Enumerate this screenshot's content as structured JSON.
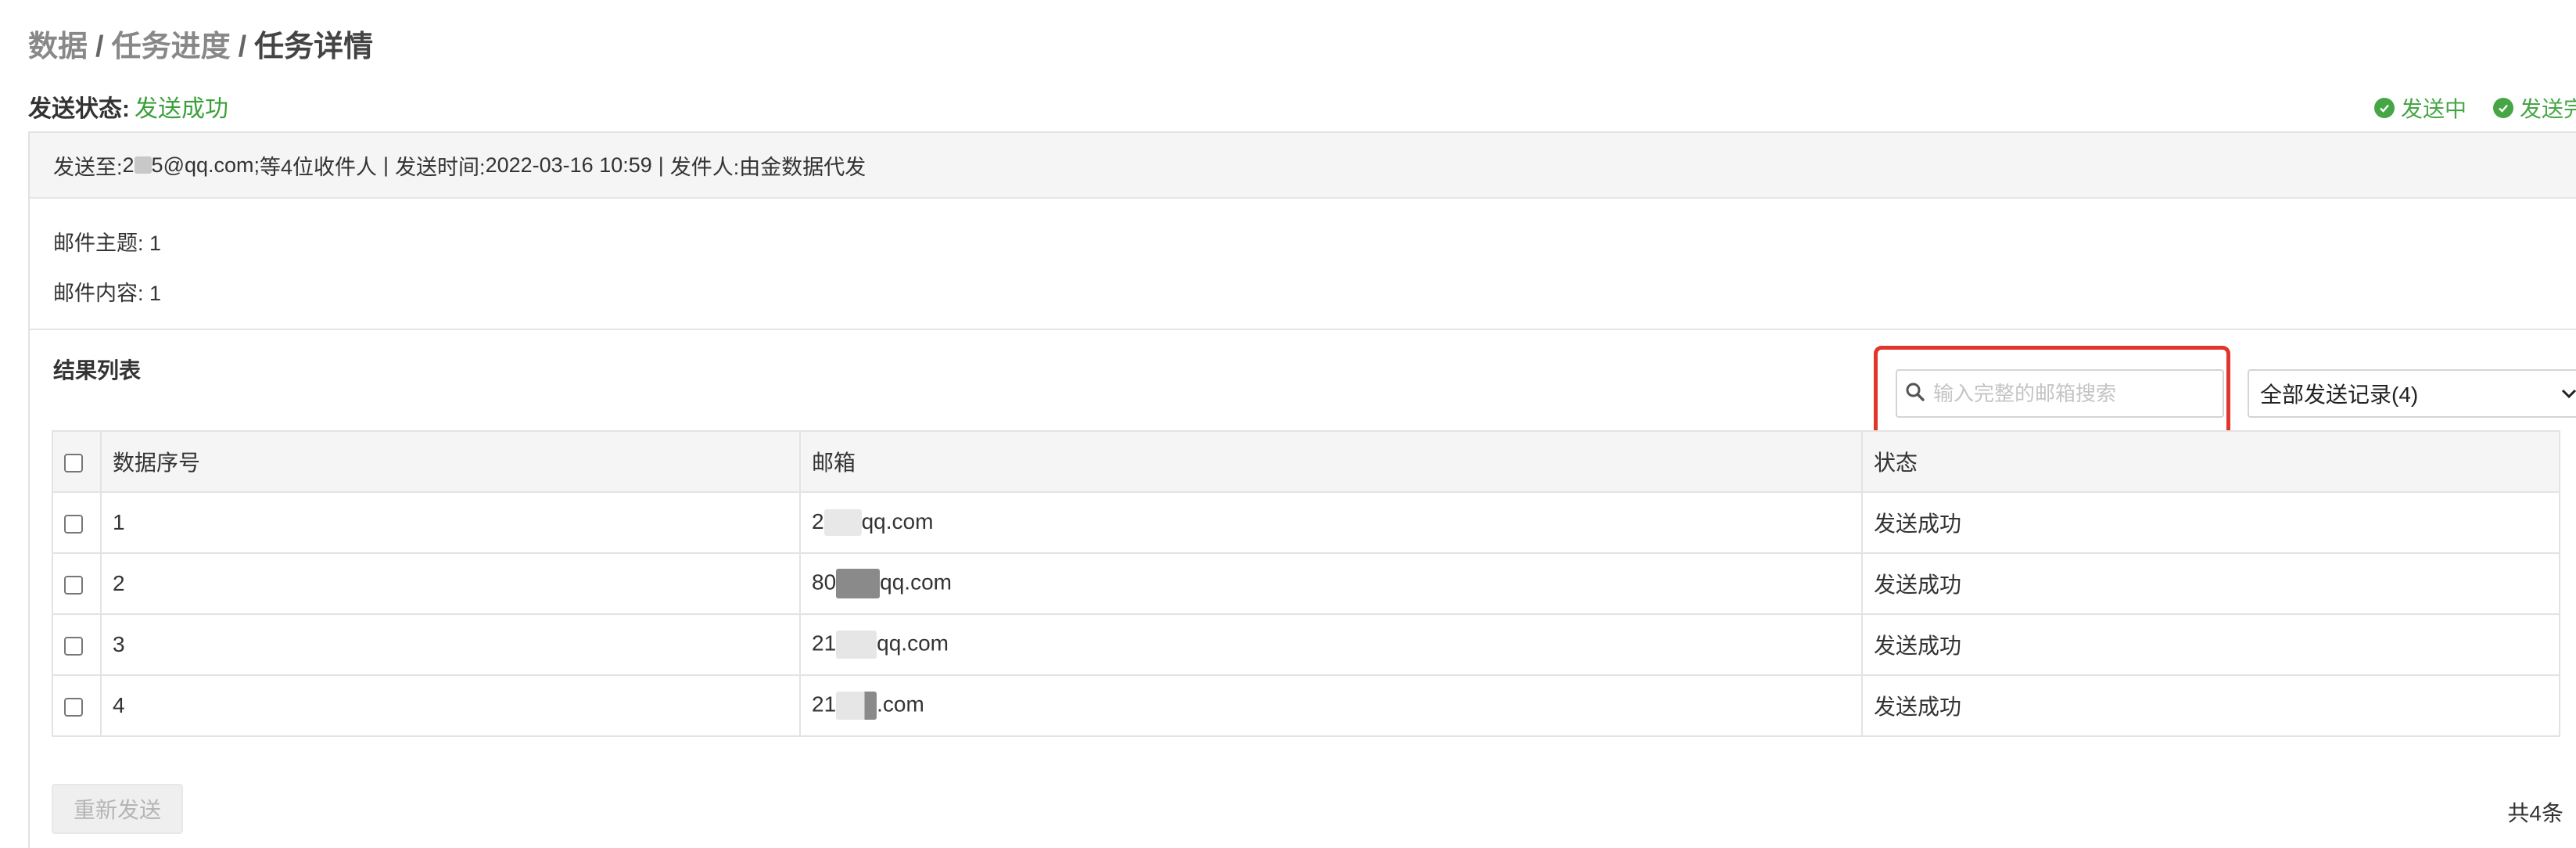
{
  "breadcrumb": {
    "item1": "数据",
    "item2": "任务进度",
    "item3": "任务详情",
    "separator": "/"
  },
  "status": {
    "label": "发送状态:",
    "value": "发送成功"
  },
  "legend": {
    "sending": "发送中",
    "done": "发送完成"
  },
  "meta": {
    "to_label": "发送至:",
    "to_prefix": "2",
    "to_suffix": "5@qq.com;",
    "recipients": "等4位收件人",
    "time_label": "发送时间:",
    "time_value": "2022-03-16 10:59",
    "sender_label": "发件人:",
    "sender_value": "由金数据代发",
    "divider": "|"
  },
  "mail": {
    "subject_label": "邮件主题:",
    "subject_value": "1",
    "content_label": "邮件内容:",
    "content_value": "1"
  },
  "results": {
    "title": "结果列表",
    "search_placeholder": "输入完整的邮箱搜索",
    "filter_selected": "全部发送记录(4)",
    "columns": {
      "index": "数据序号",
      "email": "邮箱",
      "status": "状态"
    },
    "rows": [
      {
        "index": "1",
        "email_prefix": "2",
        "email_suffix": "qq.com",
        "status": "发送成功"
      },
      {
        "index": "2",
        "email_prefix": "80",
        "email_suffix": "qq.com",
        "status": "发送成功"
      },
      {
        "index": "3",
        "email_prefix": "21",
        "email_suffix": "qq.com",
        "status": "发送成功"
      },
      {
        "index": "4",
        "email_prefix": "21",
        "email_suffix": ".com",
        "status": "发送成功"
      }
    ],
    "resend_label": "重新发送",
    "total_label": "共4条"
  },
  "colors": {
    "success": "#3aa03a",
    "highlight": "#e0362c"
  },
  "icons": {
    "search": "search-icon",
    "check": "check-circle-icon",
    "dropdown": "chevron-down-icon"
  }
}
